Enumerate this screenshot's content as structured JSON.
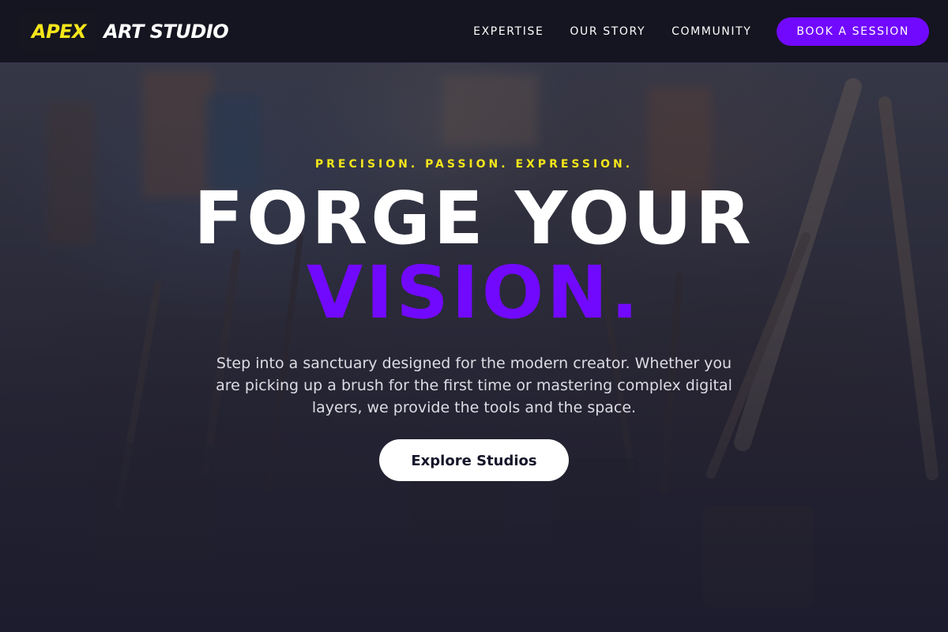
{
  "brand": {
    "accent_word": "APEX",
    "name": "ART STUDIO",
    "accent_color": "#f5e61a"
  },
  "nav": {
    "links": [
      {
        "label": "EXPERTISE"
      },
      {
        "label": "OUR STORY"
      },
      {
        "label": "COMMUNITY"
      }
    ],
    "cta_label": "BOOK A SESSION",
    "cta_color": "#7209ff"
  },
  "hero": {
    "tagline": "PRECISION. PASSION. EXPRESSION.",
    "headline_line1": "FORGE YOUR",
    "headline_line2": "VISION.",
    "description": "Step into a sanctuary designed for the modern creator. Whether you are picking up a brush for the first time or mastering complex digital layers, we provide the tools and the space.",
    "cta_label": "Explore Studios"
  }
}
